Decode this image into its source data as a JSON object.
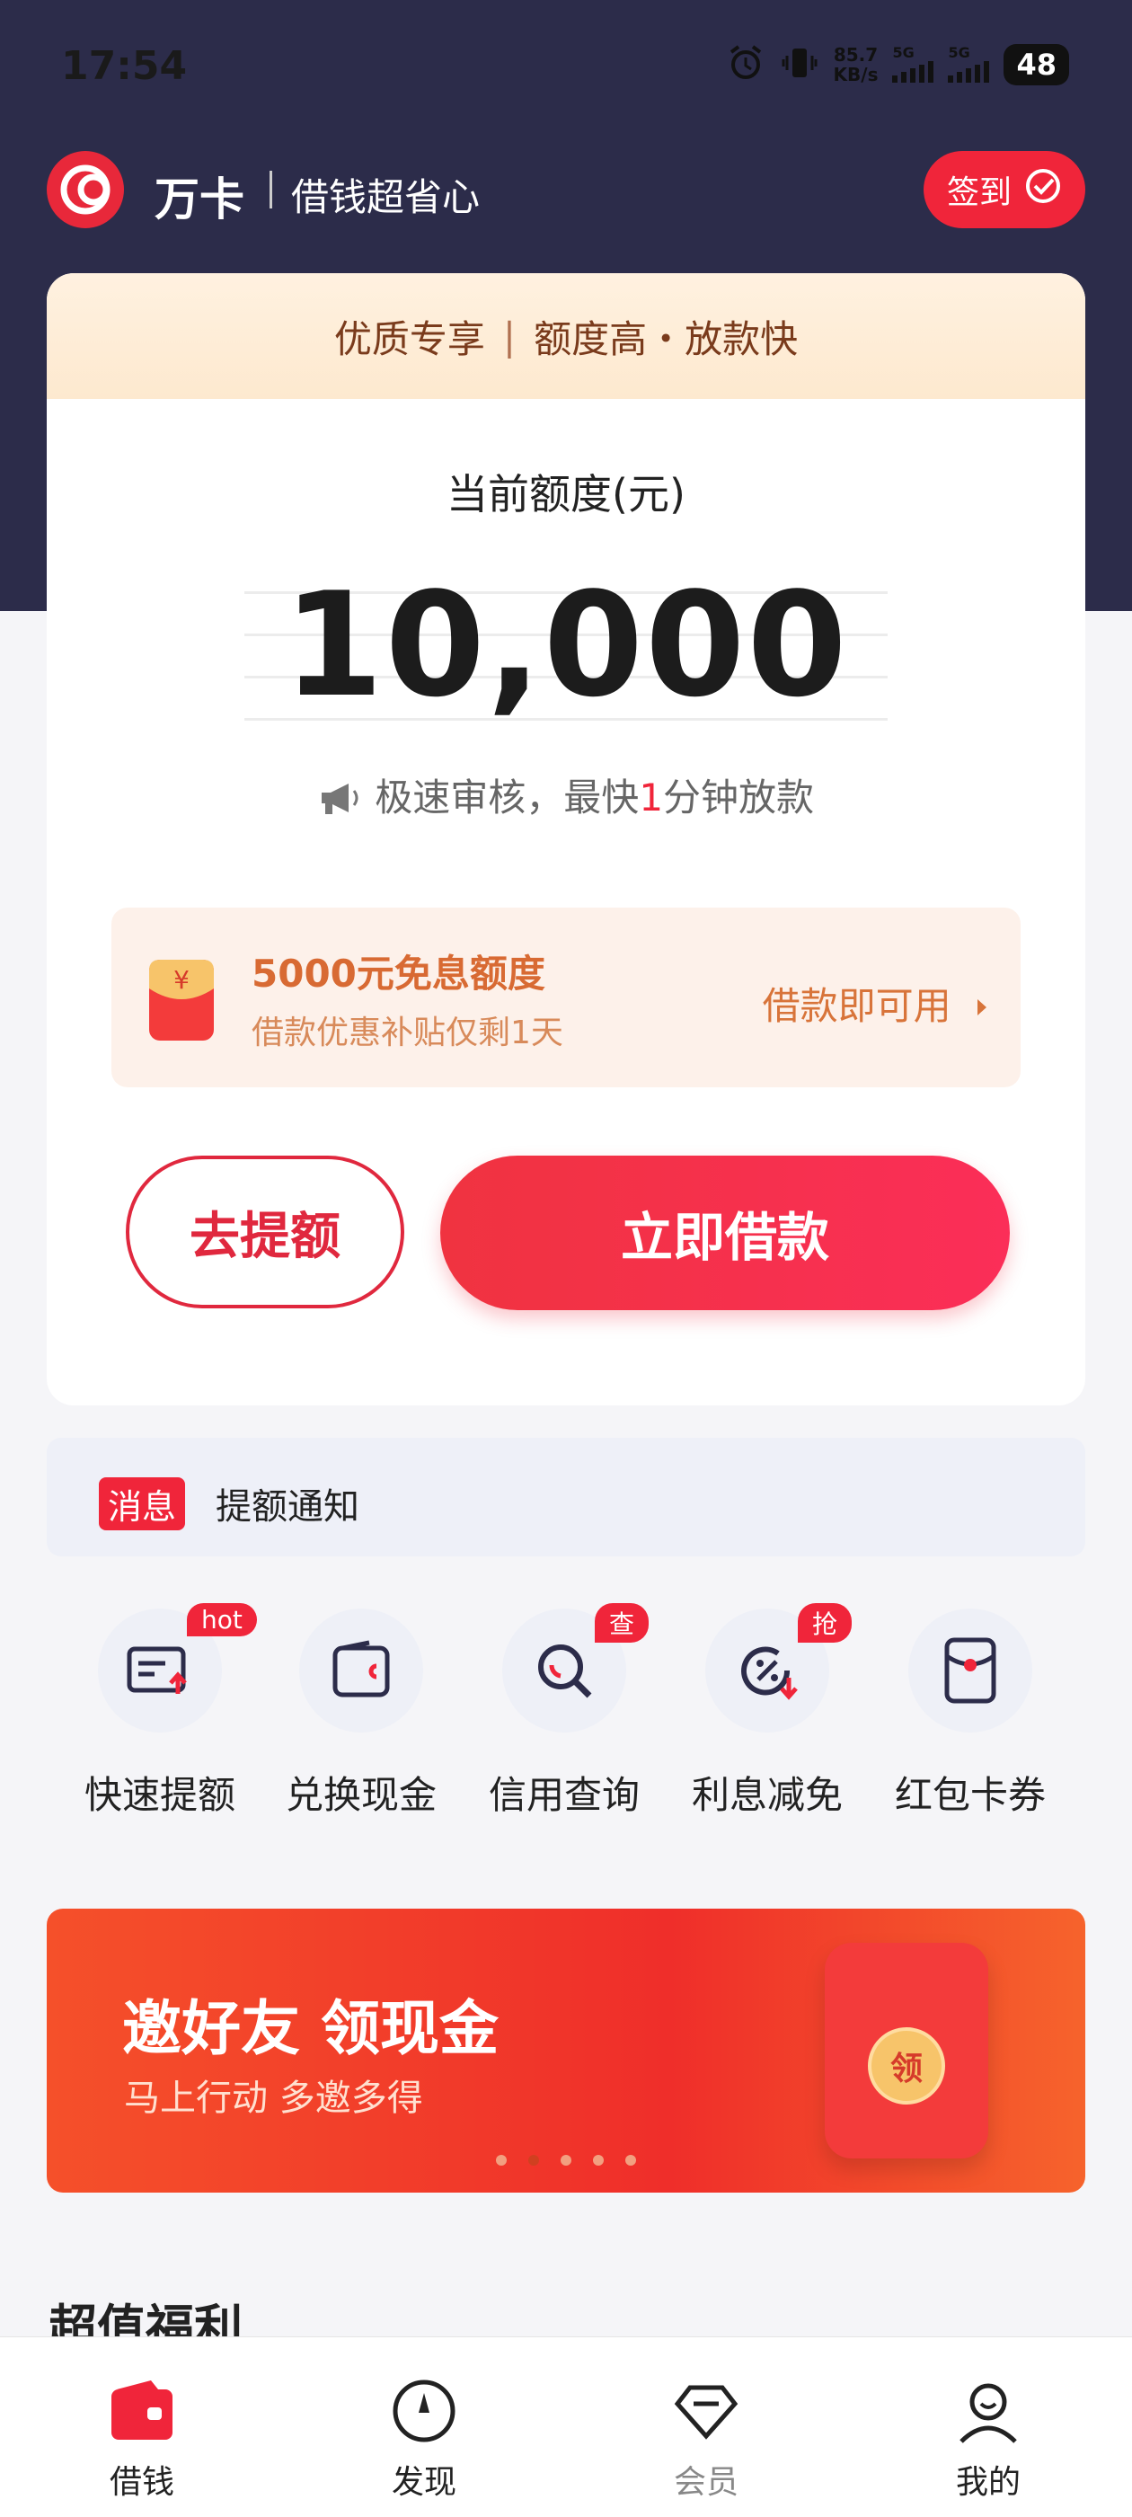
{
  "status_bar": {
    "time": "17:54",
    "net_speed_value": "85.7",
    "net_speed_unit": "KB/s",
    "sim1": "5G",
    "sim2": "5G",
    "battery": "48"
  },
  "header": {
    "brand": "万卡",
    "slogan": "借钱超省心",
    "signin_label": "签到"
  },
  "card": {
    "banner_left": "优质专享",
    "banner_right": "额度高・放款快",
    "limit_label": "当前额度(元)",
    "limit_value": "10,000",
    "notice_before": "极速审核，最快",
    "notice_highlight": "1",
    "notice_after": "分钟放款",
    "coupon": {
      "title": "5000元免息额度",
      "subtitle": "借款优惠补贴仅剩1天",
      "action": "借款即可用"
    },
    "raise_button": "去提额",
    "borrow_button": "立即借款"
  },
  "message_bar": {
    "tag": "消息",
    "text": "提额通知"
  },
  "shortcuts": [
    {
      "label": "快速提额",
      "badge": "hot",
      "icon": "card-arrow-up-icon"
    },
    {
      "label": "兑换现金",
      "badge": "",
      "icon": "wallet-icon"
    },
    {
      "label": "信用查询",
      "badge": "查",
      "icon": "magnifier-icon"
    },
    {
      "label": "利息减免",
      "badge": "抢",
      "icon": "percent-down-icon"
    },
    {
      "label": "红包卡券",
      "badge": "",
      "icon": "coupon-icon"
    }
  ],
  "promo": {
    "title": "邀好友 领现金",
    "subtitle": "马上行动 多邀多得",
    "seal_text": "领",
    "dots_total": 5,
    "dots_active": 2
  },
  "section_title": "超值福利",
  "tabbar": [
    {
      "label": "借钱",
      "active": true
    },
    {
      "label": "发现",
      "active": false
    },
    {
      "label": "会员",
      "active": false
    },
    {
      "label": "我的",
      "active": false
    }
  ],
  "colors": {
    "accent": "#f0253a",
    "header_bg": "#2c2c4a",
    "coupon_text": "#d86a33"
  }
}
